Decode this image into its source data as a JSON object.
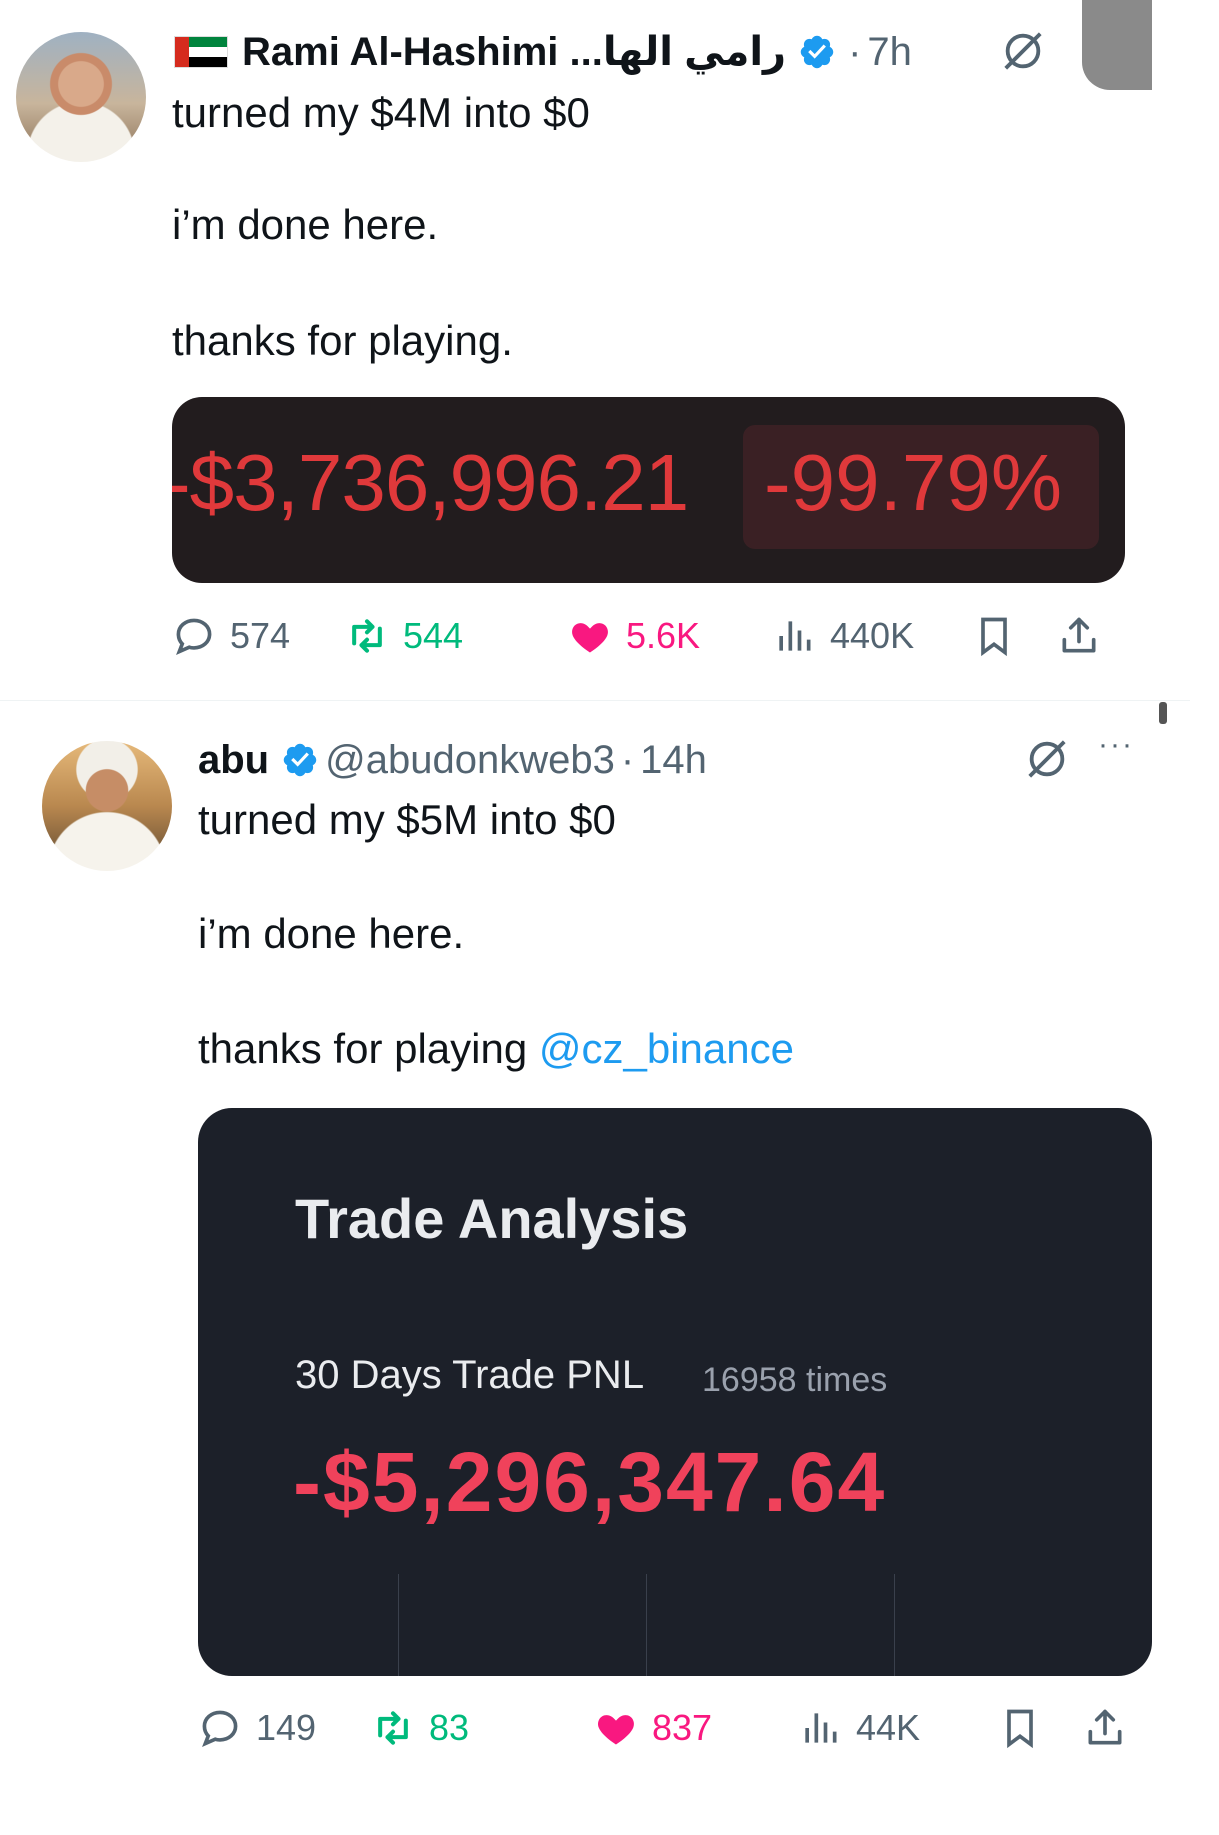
{
  "tweets": [
    {
      "display_name": "Rami Al-Hashimi ...رامي الها",
      "flag_icon": "uae-flag-icon",
      "verified_color": "#1d9bf0",
      "dot": "·",
      "time": "7h",
      "text_lines": [
        "turned my $4M into $0",
        "i’m done here.",
        "thanks for playing."
      ],
      "media": {
        "pnl_amount": "-$3,736,996.21",
        "pnl_percent": "-99.79%",
        "color": "#e0393b"
      },
      "stats": {
        "replies": "574",
        "reposts": "544",
        "likes": "5.6K",
        "views": "440K"
      }
    },
    {
      "display_name": "abu",
      "handle": "@abudonkweb3",
      "dot": "·",
      "time": "14h",
      "more": "···",
      "text_lines": [
        "turned my $5M into $0",
        "i’m done here.",
        "thanks for playing "
      ],
      "mention": "@cz_binance",
      "media": {
        "title": "Trade Analysis",
        "label": "30 Days Trade PNL",
        "times": "16958 times",
        "value": "-$5,296,347.64",
        "color": "#f0425b"
      },
      "stats": {
        "replies": "149",
        "reposts": "83",
        "likes": "837",
        "views": "44K"
      }
    }
  ],
  "colors": {
    "accent": "#1d9bf0",
    "repost_green": "#00ba7c",
    "like_pink": "#f91880",
    "muted": "#536471"
  }
}
